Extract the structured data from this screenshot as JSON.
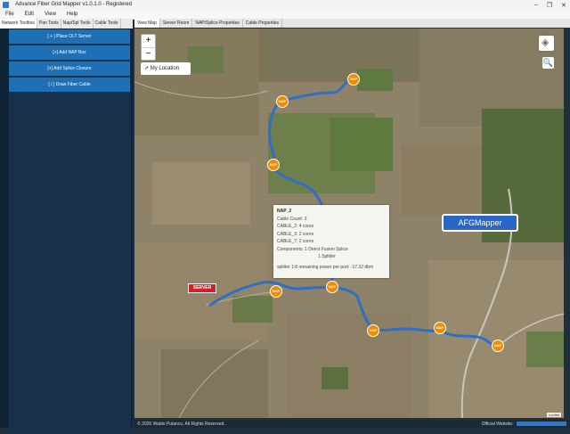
{
  "window": {
    "title": "Advance Fiber Grid Mapper v1.0.1.0 - Registered",
    "controls": [
      "–",
      "❐",
      "✕"
    ]
  },
  "menu": [
    "File",
    "Edit",
    "View",
    "Help"
  ],
  "left_tabs": [
    "Network Toolbox",
    "Pan Tools",
    "Nap/Spl Tools",
    "Cable Tools"
  ],
  "left_tabs_active": "Network Toolbox",
  "toolbox": [
    "[ + ] Place OLT Server",
    "[+] Add NAP Box",
    "[+] Add Splice Closure",
    "[ / ] Draw Fiber Cable"
  ],
  "right_tabs": [
    "View Map",
    "Server Room",
    "NAP/Splice Properties",
    "Cable Properties"
  ],
  "right_tabs_active": "View Map",
  "map": {
    "zoom_in": "+",
    "zoom_out": "−",
    "my_location": "My Location",
    "my_location_icon": "location-arrow-icon",
    "layers_icon": "layers-icon",
    "search_icon": "magnifier-icon",
    "server_label": "SERVER",
    "nap_label": "NAP",
    "brand_badge": "AFGMapper",
    "attribution": "Leaflet",
    "cable_color": "#2f6fc4",
    "nap_color": "#f28b00",
    "server_color": "#d32127",
    "popup": {
      "title": "NAP_2",
      "lines": [
        "Cable Count: 3",
        "CABLE_2: 4 cores",
        "CABLE_3: 2 cores",
        "CABLE_7: 2 cores",
        "Components: 1 Direct Fusion Splice"
      ],
      "indent_line": "1 Splitter",
      "footer": "splitter 1:8 remaining power per port: -17.32 dbm"
    }
  },
  "status": {
    "copyright": "© 2026 Waldo Pulanco, All Rights Reserved.",
    "website_label": "Official Website:"
  }
}
